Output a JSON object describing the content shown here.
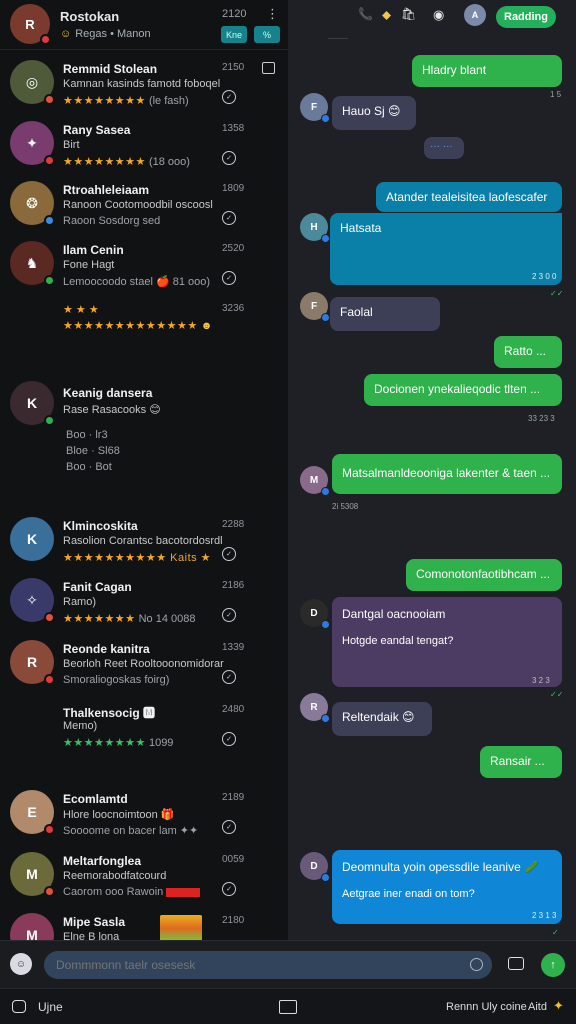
{
  "header": {
    "title": "Rostokan",
    "subtitle": "Regas • Manon",
    "time": "2120",
    "kebab": "⋮",
    "chip1": "Kne",
    "chip2": "%"
  },
  "contacts": [
    {
      "name": "Remmid Stolean",
      "line2": "Kamnan kasinds famotd foboqel",
      "stars": "★★★★★★★★",
      "rating": "(le fash)",
      "time": "2150",
      "status": "✓"
    },
    {
      "name": "Rany Sasea",
      "line2": "Birt",
      "stars": "★★★★★★★★",
      "rating": "(18 ooo)",
      "time": "1358",
      "status": "✓"
    },
    {
      "name": "Rtroahleleiaam",
      "line2": "Ranoon Cootomoodbil oscoosl",
      "line3": "Raoon Sosdorg sed",
      "time": "1809",
      "status": "✓"
    },
    {
      "name": "Ilam Cenin",
      "line2": "Fone Hagt",
      "line3": "Lemoocoodo stael 🍎 81 ooo)",
      "time": "2520",
      "status": "✓"
    },
    {
      "name": "",
      "line2": "★ ★ ★",
      "stars": "★★★★★★★★★★★★★",
      "time": "3236",
      "status": ""
    },
    {
      "name": "Keanig dansera",
      "line2": "Rase Rasacooks 😊",
      "line3": "Boo  · lr3",
      "line4": "Bloe  · Sl68",
      "line5": "Boo  · Bot",
      "time": "",
      "status": ""
    },
    {
      "name": "Klmincoskita",
      "line2": "Rasolion Corantsc bacotordosrdl",
      "stars": "★★★★★★★★★★ Kaits ★",
      "time": "2288",
      "status": "✓"
    },
    {
      "name": "Fanit Cagan",
      "line2": "Ramo)",
      "stars": "★★★★★★★",
      "rating": "No 14 0088",
      "time": "2186",
      "status": "✓"
    },
    {
      "name": "Reonde kanitra",
      "line2": "Beorloh Reet Rooltooonomidorar",
      "line3": "Smoraliogoskas foirg)",
      "time": "1339",
      "status": "✓"
    },
    {
      "name": "Thalkensocig 🅼",
      "line2": "Memo)",
      "stars": "★★★★★★★★",
      "rating": "1099",
      "time": "2480",
      "status": "✓"
    },
    {
      "name": "Ecomlamtd",
      "line2": "Hlore loocnoimtoon 🎁",
      "line3": "Soooome on bacer lam ✦✦",
      "time": "2189",
      "status": "✓"
    },
    {
      "name": "Meltarfonglea",
      "line2": "Reemorabodfatcourd",
      "line3": "Caorom ooo Rawoin",
      "time": "0059",
      "status": "✓"
    },
    {
      "name": "Mipe Sasla",
      "line2": "Elne B lona",
      "time": "2180",
      "status": ""
    }
  ],
  "topbar": {
    "phone_icon": "📞",
    "pin_icon": "⬥",
    "cart_icon": "🛍",
    "whatsapp_icon": "◉",
    "button": "Radding"
  },
  "messages": [
    {
      "text": "Hladry blant",
      "meta": "1 5"
    },
    {
      "text": "Hauo Sj 😊"
    },
    {
      "text": "··· ···"
    },
    {
      "text": "Atander tealeisitea laofescafer"
    },
    {
      "text": "Hatsata",
      "meta": "2 3 0 0"
    },
    {
      "text": "Faolal"
    },
    {
      "text": "Ratto ..."
    },
    {
      "text": "Docionen ynekalieqodic tlten ...",
      "meta": "33 23 3"
    },
    {
      "text": "Matsalmanldeooniga lakenter & taen ...",
      "meta": "2i 5308"
    },
    {
      "text": "Comonotonfaotibhcam ..."
    },
    {
      "text": "Dantgal oacnooiam",
      "line2": "Hotgde eandal tengat?",
      "meta": "3 2 3"
    },
    {
      "text": "Reltendaik 😊"
    },
    {
      "text": "Ransair ..."
    },
    {
      "text": "Deomnulta yoin opessdile leanive 🥒",
      "line2": "Aetgrae iner enadi on tom?",
      "meta": "2 3 1 3"
    }
  ],
  "inputbar": {
    "placeholder": "Dommmonn taelr osesesk",
    "send_label": "↑"
  },
  "bottombar": {
    "left_label": "Ujne",
    "right_label": "Rennn Uly coine",
    "right2_label": "Aitd"
  }
}
